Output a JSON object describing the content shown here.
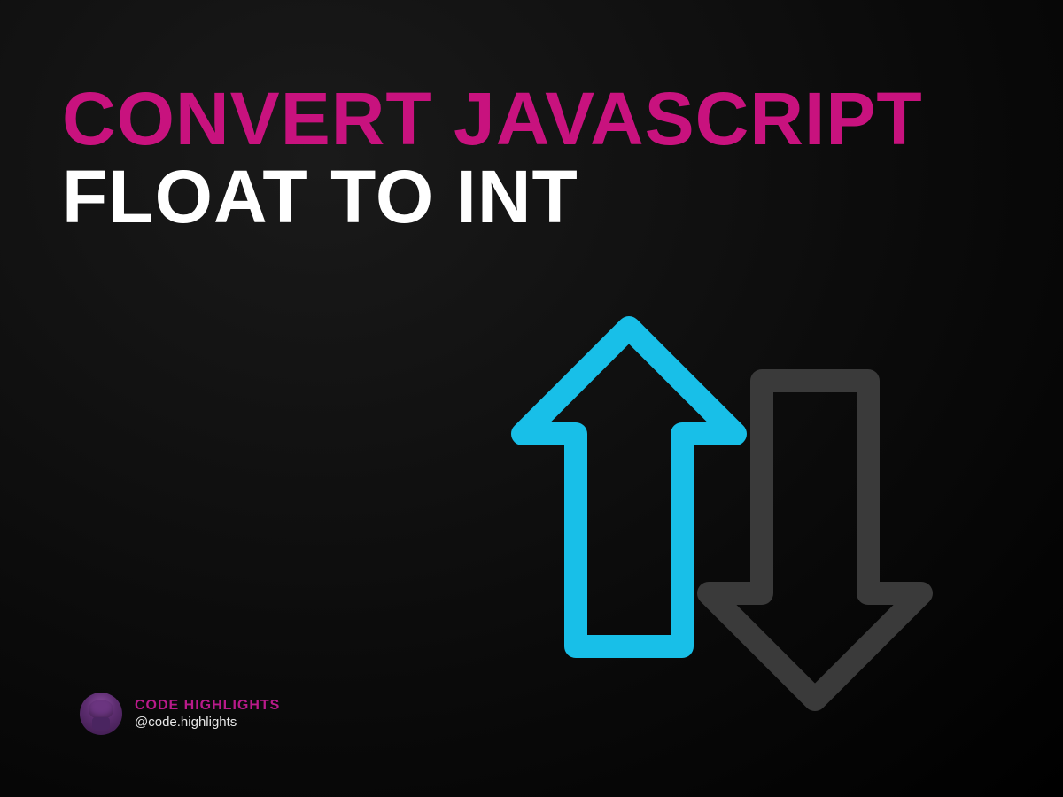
{
  "heading": {
    "line1": "CONVERT JAVASCRIPT",
    "line2": "FLOAT TO INT"
  },
  "icons": {
    "up_arrow": "arrow-up-icon",
    "down_arrow": "arrow-down-icon"
  },
  "colors": {
    "accent_pink": "#c8127e",
    "accent_cyan": "#18bfe8",
    "arrow_gray": "#3a3a3a",
    "text_white": "#ffffff",
    "background": "#0a0a0a"
  },
  "footer": {
    "brand": "CODE HIGHLIGHTS",
    "handle": "@code.highlights",
    "avatar_label": "code-highlights-avatar"
  }
}
